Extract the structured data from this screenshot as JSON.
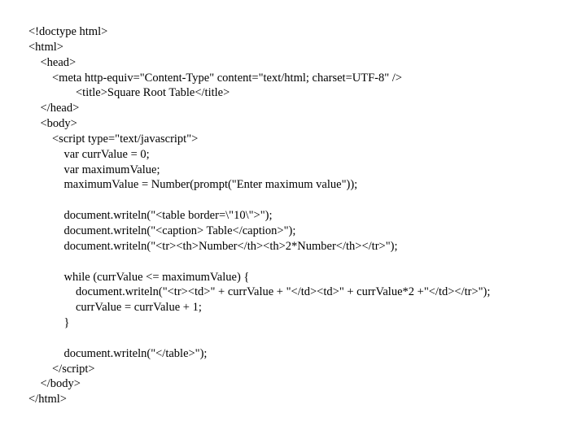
{
  "lines": [
    "<!doctype html>",
    "<html>",
    "    <head>",
    "        <meta http-equiv=\"Content-Type\" content=\"text/html; charset=UTF-8\" />",
    "                <title>Square Root Table</title>",
    "    </head>",
    "    <body>",
    "        <script type=\"text/javascript\">",
    "            var currValue = 0;",
    "            var maximumValue;",
    "            maximumValue = Number(prompt(\"Enter maximum value\"));",
    "",
    "            document.writeln(\"<table border=\\\"10\\\">\");",
    "            document.writeln(\"<caption> Table</caption>\");",
    "            document.writeln(\"<tr><th>Number</th><th>2*Number</th></tr>\");",
    "",
    "            while (currValue <= maximumValue) {",
    "                document.writeln(\"<tr><td>\" + currValue + \"</td><td>\" + currValue*2 +\"</td></tr>\");",
    "                currValue = currValue + 1;",
    "            }",
    "",
    "            document.writeln(\"</table>\");",
    "        </script>",
    "    </body>",
    "</html>"
  ]
}
